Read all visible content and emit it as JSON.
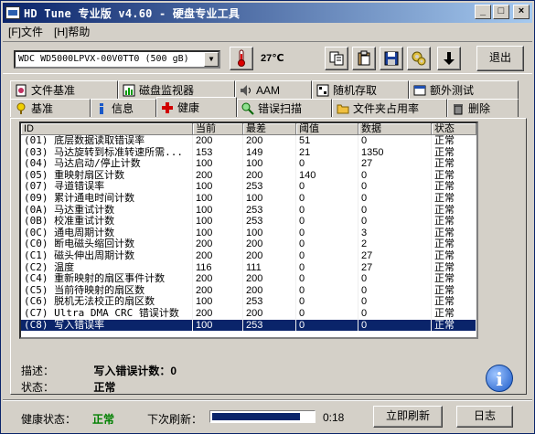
{
  "window": {
    "title": "HD Tune 专业版 v4.60 - 硬盘专业工具",
    "minimize": "_",
    "maximize": "□",
    "close": "×"
  },
  "menu": [
    "[F]文件",
    "[H]帮助"
  ],
  "toolbar": {
    "drive": "WDC WD5000LPVX-00V0TT0   (500 gB)",
    "temperature": "27℃",
    "exit_label": "退出"
  },
  "tabs_top": [
    {
      "label": "文件基准",
      "icon": "file-benchmark-icon"
    },
    {
      "label": "磁盘监视器",
      "icon": "disk-monitor-icon"
    },
    {
      "label": "AAM",
      "icon": "speaker-icon"
    },
    {
      "label": "随机存取",
      "icon": "random-access-icon"
    },
    {
      "label": "额外测试",
      "icon": "extra-tests-icon"
    }
  ],
  "tabs_bottom": [
    {
      "label": "基准",
      "icon": "benchmark-icon"
    },
    {
      "label": "信息",
      "icon": "info-icon"
    },
    {
      "label": "健康",
      "icon": "health-cross-icon"
    },
    {
      "label": "错误扫描",
      "icon": "magnifier-icon"
    },
    {
      "label": "文件夹占用率",
      "icon": "folder-icon"
    },
    {
      "label": "删除",
      "icon": "trash-icon"
    }
  ],
  "colors": {
    "selected_row": "#0a246a",
    "status_ok": "#008000",
    "health_cross": "#d00000"
  },
  "table": {
    "headers": [
      "ID",
      "当前",
      "最差",
      "阈值",
      "数据",
      "状态"
    ],
    "rows": [
      [
        "(01) 底层数据读取错误率",
        "200",
        "200",
        "51",
        "0",
        "正常"
      ],
      [
        "(03) 马达旋转到标准转速所需...",
        "153",
        "149",
        "21",
        "1350",
        "正常"
      ],
      [
        "(04) 马达启动/停止计数",
        "100",
        "100",
        "0",
        "27",
        "正常"
      ],
      [
        "(05) 重映射扇区计数",
        "200",
        "200",
        "140",
        "0",
        "正常"
      ],
      [
        "(07) 寻道错误率",
        "100",
        "253",
        "0",
        "0",
        "正常"
      ],
      [
        "(09) 累计通电时间计数",
        "100",
        "100",
        "0",
        "0",
        "正常"
      ],
      [
        "(0A) 马达重试计数",
        "100",
        "253",
        "0",
        "0",
        "正常"
      ],
      [
        "(0B) 校准重试计数",
        "100",
        "253",
        "0",
        "0",
        "正常"
      ],
      [
        "(0C) 通电周期计数",
        "100",
        "100",
        "0",
        "3",
        "正常"
      ],
      [
        "(C0) 断电磁头缩回计数",
        "200",
        "200",
        "0",
        "2",
        "正常"
      ],
      [
        "(C1) 磁头伸出周期计数",
        "200",
        "200",
        "0",
        "27",
        "正常"
      ],
      [
        "(C2) 温度",
        "116",
        "111",
        "0",
        "27",
        "正常"
      ],
      [
        "(C4) 重新映射的扇区事件计数",
        "200",
        "200",
        "0",
        "0",
        "正常"
      ],
      [
        "(C5) 当前待映射的扇区数",
        "200",
        "200",
        "0",
        "0",
        "正常"
      ],
      [
        "(C6) 脱机无法校正的扇区数",
        "100",
        "253",
        "0",
        "0",
        "正常"
      ],
      [
        "(C7) Ultra DMA CRC 错误计数",
        "200",
        "200",
        "0",
        "0",
        "正常"
      ],
      [
        "(C8) 写入错误率",
        "100",
        "253",
        "0",
        "0",
        "正常"
      ]
    ]
  },
  "description": {
    "desc_label": "描述：",
    "desc_value": "写入错误计数：0",
    "state_label": "状态：",
    "state_value": "正常"
  },
  "statusbar": {
    "health_label": "健康状态：",
    "health_value": "正常",
    "next_refresh_label": "下次刷新：",
    "progress": 0.88,
    "time": "0:18",
    "refresh_label": "立即刷新",
    "log_label": "日志"
  }
}
